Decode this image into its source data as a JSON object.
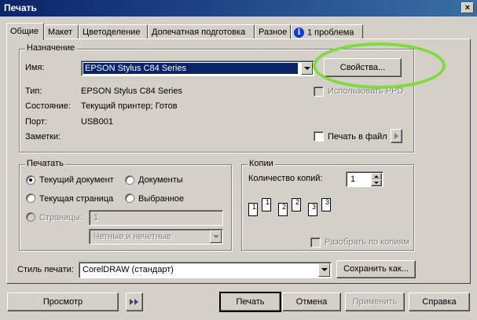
{
  "window": {
    "title": "Печать",
    "close_label": "×"
  },
  "tabs": [
    {
      "label": "Общие"
    },
    {
      "label": "Макет"
    },
    {
      "label": "Цветоделение"
    },
    {
      "label": "Допечатная подготовка"
    },
    {
      "label": "Разное"
    },
    {
      "label": "1 проблема"
    }
  ],
  "destination": {
    "group_label": "Назначение",
    "name_label": "Имя:",
    "name_value": "EPSON Stylus C84 Series",
    "properties_button": "Свойства...",
    "use_ppd_label": "Использовать PPD",
    "type_label": "Тип:",
    "type_value": "EPSON Stylus C84 Series",
    "state_label": "Состояние:",
    "state_value": "Текущий принтер; Готов",
    "port_label": "Порт:",
    "port_value": "USB001",
    "notes_label": "Заметки:",
    "print_to_file_label": "Печать в файл"
  },
  "print_range": {
    "group_label": "Печатать",
    "current_document": "Текущий документ",
    "documents": "Документы",
    "current_page": "Текущая страница",
    "selection": "Выбранное",
    "pages_label": "Страницы:",
    "pages_value": "1",
    "odd_even_value": "Четные и нечетные"
  },
  "copies": {
    "group_label": "Копии",
    "count_label": "Количество копий:",
    "count_value": "1",
    "collate_label": "Разобрать по копиям",
    "page_numbers": [
      "1",
      "1",
      "2",
      "2",
      "3",
      "3"
    ]
  },
  "style": {
    "label": "Стиль печати:",
    "value": "CorelDRAW (стандарт)",
    "save_as_button": "Сохранить как..."
  },
  "footer": {
    "preview_button": "Просмотр",
    "print_button": "Печать",
    "cancel_button": "Отмена",
    "apply_button": "Применить",
    "help_button": "Справка"
  },
  "colors": {
    "highlight": "#7ddc3c",
    "title_start": "#0a246a",
    "title_end": "#3a6ea5",
    "selection": "#0a246a"
  }
}
